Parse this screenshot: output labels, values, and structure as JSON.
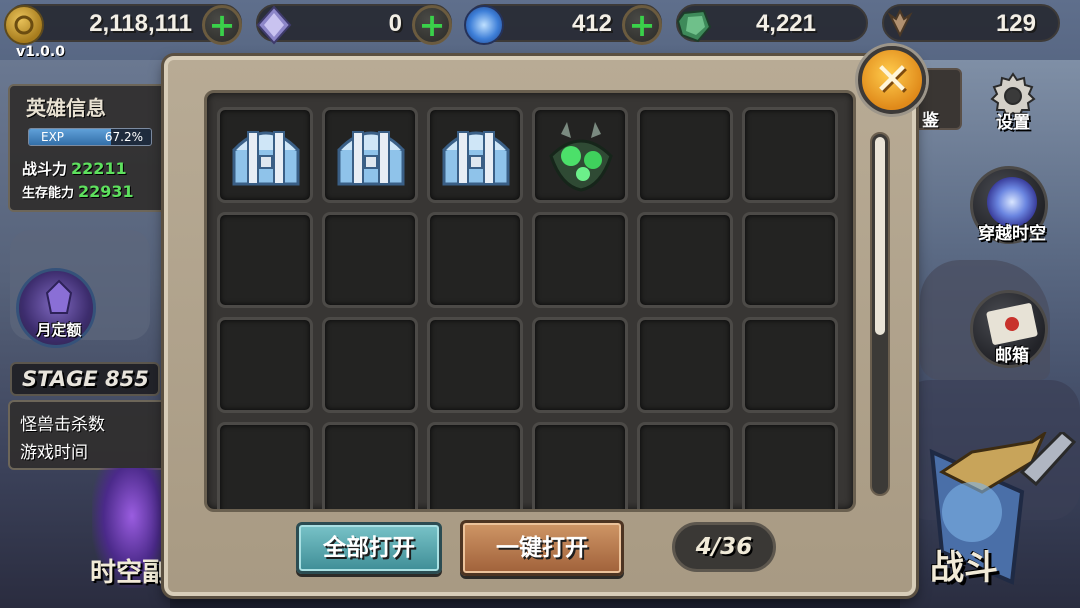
{
  "resources": [
    {
      "name": "gold",
      "icon": "gold-coin-icon",
      "value": "2,118,111",
      "has_plus": true
    },
    {
      "name": "crystal",
      "icon": "crystal-icon",
      "value": "0",
      "has_plus": true
    },
    {
      "name": "energy-orb",
      "icon": "energy-orb-icon",
      "value": "412",
      "has_plus": true
    },
    {
      "name": "emerald",
      "icon": "emerald-icon",
      "value": "4,221",
      "has_plus": false
    },
    {
      "name": "wings",
      "icon": "wings-emblem-icon",
      "value": "129",
      "has_plus": false
    }
  ],
  "plus_symbol": "+",
  "version": "v1.0.0",
  "hero": {
    "title": "英雄信息",
    "exp_label": "EXP",
    "exp_value": "67.2%",
    "exp_fraction": 0.672,
    "power_label": "战斗力",
    "power_value": "22211",
    "survival_label": "生存能力",
    "survival_value": "22931"
  },
  "month_quota": "月定额",
  "stage": "STAGE 855",
  "kill_panel": {
    "kills": "怪兽击杀数",
    "playtime": "游戏时间"
  },
  "portal_label": "时空副",
  "right_menu": {
    "almanac": "鉴",
    "settings": "设置",
    "warp": "穿越时空",
    "mail": "邮箱",
    "battle": "战斗"
  },
  "bag": {
    "close_symbol": "✕",
    "items": [
      "silver-chest-icon",
      "silver-chest-icon",
      "silver-chest-icon",
      "jade-armor-icon"
    ],
    "rows_visible": 4,
    "cols": 6,
    "open_all_label": "全部打开",
    "one_click_open_label": "一键打开",
    "count": "4/36"
  },
  "colors": {
    "power_green": "#5ee05e",
    "accent_orange": "#e08a1a",
    "teal_button": "#3e8d96",
    "brown_button": "#a0613a"
  }
}
